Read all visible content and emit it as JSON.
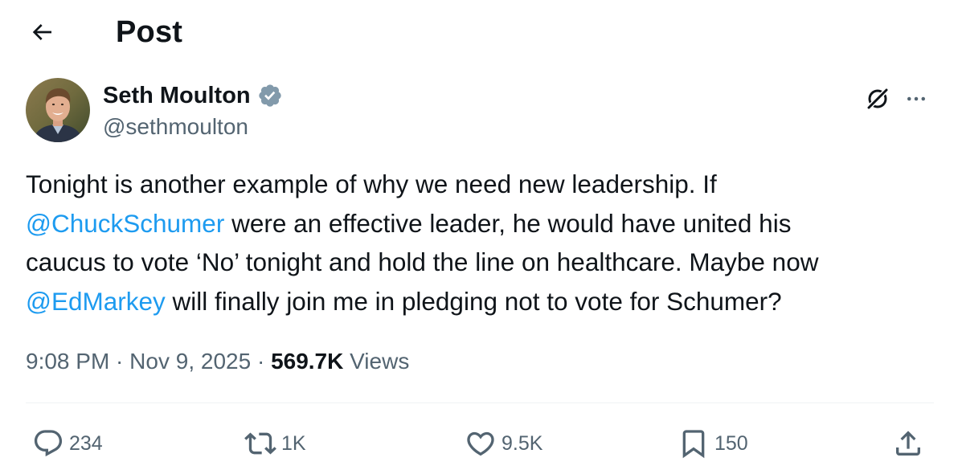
{
  "header": {
    "back_icon": "arrow-left-icon",
    "title": "Post"
  },
  "author": {
    "name": "Seth Moulton",
    "handle": "@sethmoulton",
    "verified_icon": "verified-badge-icon",
    "verified_color": "#829aab",
    "avatar_icon": "user-avatar"
  },
  "post": {
    "lines": [
      [
        {
          "text": "Tonight is another example of why we need new leadership. If",
          "mention": false
        }
      ],
      [
        {
          "text": "@ChuckSchumer",
          "mention": true
        },
        {
          "text": " were an effective leader, he would have united his",
          "mention": false
        }
      ],
      [
        {
          "text": "caucus to vote ‘No’ tonight and hold the line on healthcare. Maybe now",
          "mention": false
        }
      ],
      [
        {
          "text": "@EdMarkey",
          "mention": true
        },
        {
          "text": " will finally join me in pledging not to vote for Schumer?",
          "mention": false
        }
      ]
    ]
  },
  "meta": {
    "time": "9:08 PM",
    "separator": " · ",
    "date": "Nov 9, 2025",
    "views_count": "569.7K",
    "views_label": " Views"
  },
  "actions": {
    "reply_count": "234",
    "repost_count": "1K",
    "like_count": "9.5K",
    "bookmark_count": "150"
  },
  "colors": {
    "text": "#0f1419",
    "secondary": "#536471",
    "link": "#1d9bf0",
    "divider": "#eff3f4"
  }
}
